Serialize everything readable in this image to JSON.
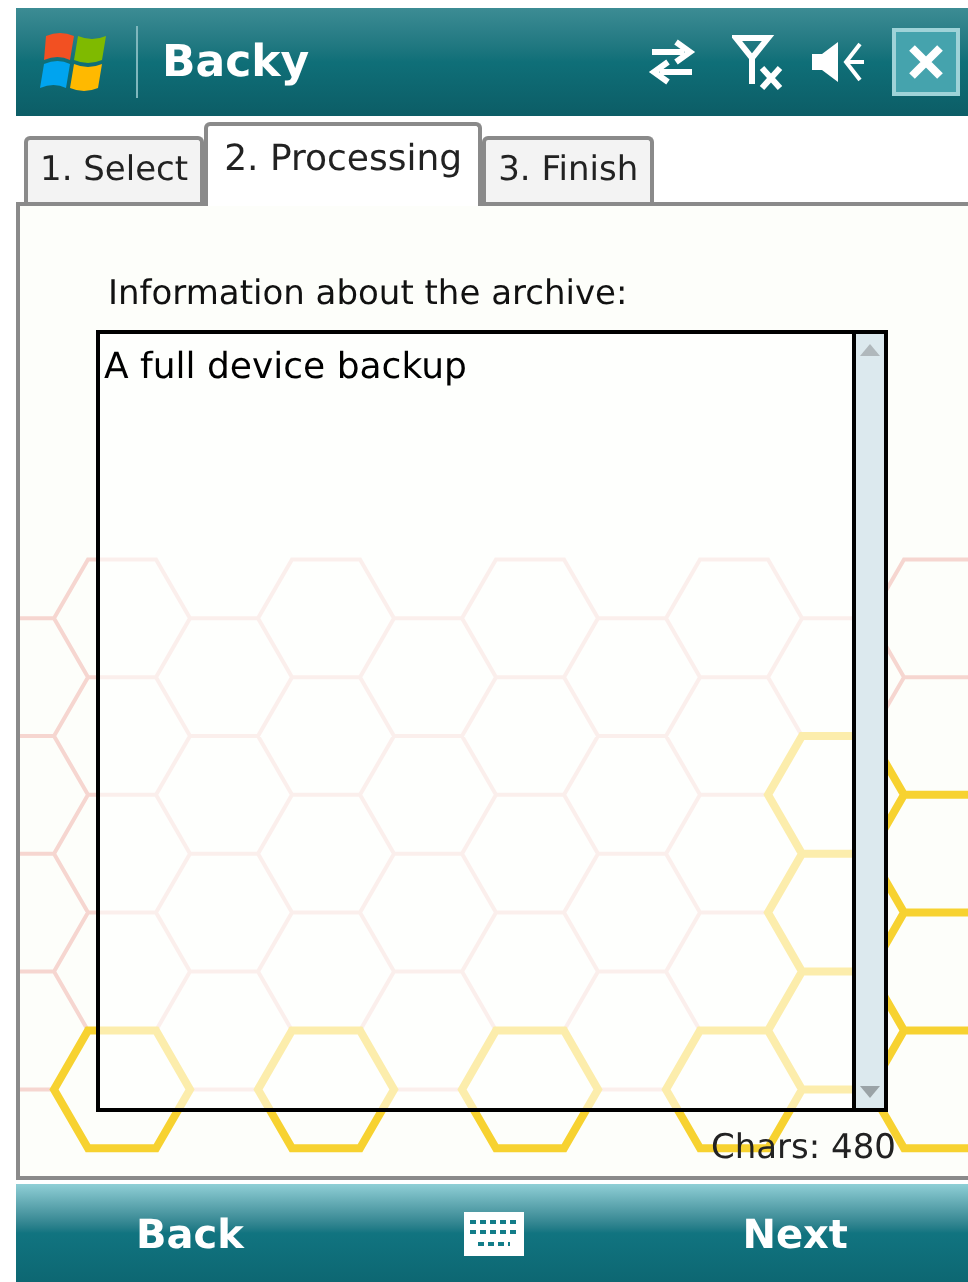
{
  "title_bar": {
    "title": "Backy"
  },
  "tabs": [
    {
      "label": "1. Select",
      "selected": false
    },
    {
      "label": "2. Processing",
      "selected": true
    },
    {
      "label": "3. Finish",
      "selected": false
    }
  ],
  "archive_info": {
    "label": "Information about the archive:",
    "value": "A full device backup"
  },
  "char_count": "Chars: 480",
  "softkeys": {
    "left": "Back",
    "right": "Next"
  }
}
